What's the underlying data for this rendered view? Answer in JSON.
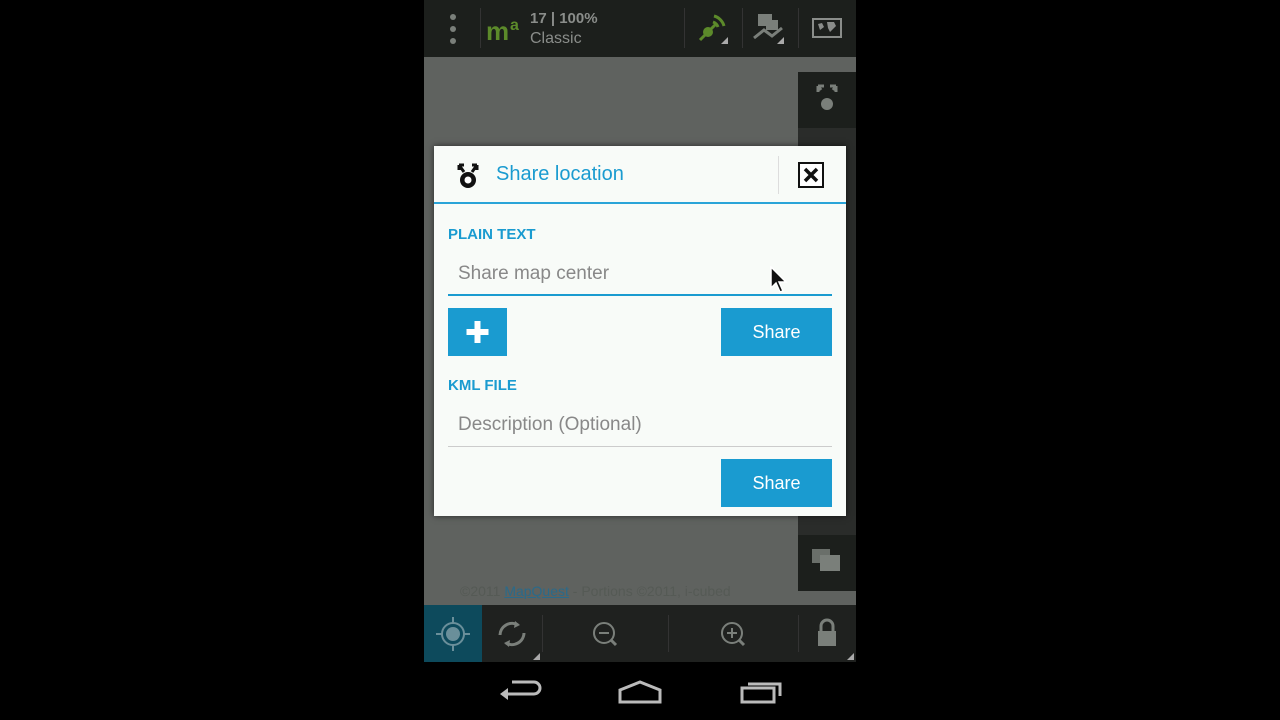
{
  "topbar": {
    "zoom_status": "17 | 100%",
    "map_style": "Classic",
    "icons": [
      "overflow-menu-icon",
      "mapquest-logo",
      "gps-signal-icon",
      "route-icon",
      "world-map-icon"
    ]
  },
  "dialog": {
    "title": "Share location",
    "plain_text_label": "PLAIN TEXT",
    "plain_text_placeholder": "Share map center",
    "share_label_1": "Share",
    "kml_label": "KML FILE",
    "kml_placeholder": "Description (Optional)",
    "share_label_2": "Share"
  },
  "attribution": {
    "prefix": "©2011 ",
    "link": "MapQuest",
    "suffix": " - Portions ©2011, i-cubed"
  },
  "colors": {
    "accent": "#1a9bd0",
    "toolbar_bg": "#1c1f1c",
    "map_bg": "#5f625f",
    "dialog_bg": "#f8fbf8",
    "locate_active": "#0d4a5c"
  }
}
